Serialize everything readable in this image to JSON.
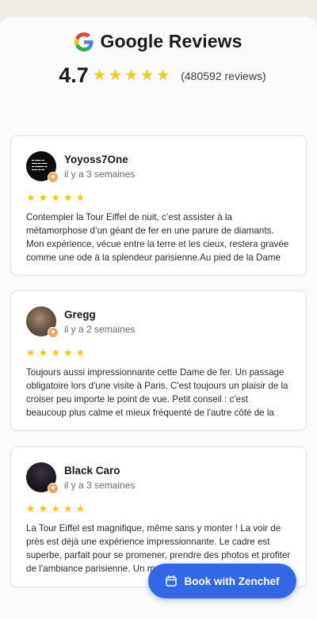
{
  "header": {
    "title": "Google Reviews",
    "rating": "4.7",
    "stars": 5,
    "review_count": "(480592 reviews)"
  },
  "reviews": [
    {
      "name": "Yoyoss7One",
      "time": "il y a 3 semaines",
      "stars": 5,
      "text": "Contempler la Tour Eiffel de nuit, c’est assister à la métamorphose d’un géant de fer en une parure de diamants. Mon expérience, vécue entre la terre et les cieux, restera gravée comme une ode à la splendeur parisienne.Au pied de la Dame de Fer, l’émotion est…"
    },
    {
      "name": "Gregg",
      "time": "il y a 2 semaines",
      "stars": 5,
      "text": "Toujours aussi impressionnante cette Dame de fer. Un passage obligatoire lors d'une visite à Paris. C'est toujours un plaisir de la croiser peu importe le point de vue. Petit conseil : c'est beaucoup plus calme et mieux fréquenté de l'autre côté de la Seine."
    },
    {
      "name": "Black Caro",
      "time": "il y a 3 semaines",
      "stars": 5,
      "text": "La Tour Eiffel est magnifique, même sans y monter ! La voir de près est déjà une expérience impressionnante. Le cadre est superbe, parfait pour se promener, prendre des photos et profiter de l’ambiance parisienne. Un monument incontournable qui fait…"
    }
  ],
  "cta": {
    "label": "Book with Zenchef"
  },
  "colors": {
    "star": "#f5c518",
    "cta_background": "#3367e6",
    "badge": "#f0a663"
  }
}
